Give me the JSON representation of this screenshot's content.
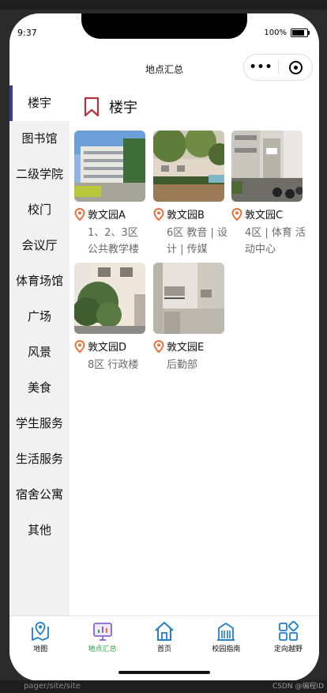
{
  "status": {
    "time": "9:37",
    "battery": "100%"
  },
  "nav": {
    "title": "地点汇总",
    "more_glyph": "•••"
  },
  "sidebar": {
    "items": [
      {
        "label": "楼宇",
        "active": true
      },
      {
        "label": "图书馆"
      },
      {
        "label": "二级学院"
      },
      {
        "label": "校门"
      },
      {
        "label": "会议厅"
      },
      {
        "label": "体育场馆"
      },
      {
        "label": "广场"
      },
      {
        "label": "风景"
      },
      {
        "label": "美食"
      },
      {
        "label": "学生服务"
      },
      {
        "label": "生活服务"
      },
      {
        "label": "宿舍公寓"
      },
      {
        "label": "其他"
      }
    ]
  },
  "section": {
    "title": "楼宇",
    "icon": "bookmark-icon"
  },
  "places": [
    {
      "name": "敦文园A",
      "desc": "1、2、3区 公共教学楼"
    },
    {
      "name": "敦文园B",
      "desc": "6区 教音 | 设计 | 传媒"
    },
    {
      "name": "敦文园C",
      "desc": "4区 | 体育 活动中心"
    },
    {
      "name": "敦文园D",
      "desc": "8区 行政楼"
    },
    {
      "name": "敦文园E",
      "desc": "后勤部"
    }
  ],
  "tabs": [
    {
      "label": "地图",
      "icon": "map-pin-icon"
    },
    {
      "label": "地点汇总",
      "icon": "chart-board-icon",
      "active": true
    },
    {
      "label": "首页",
      "icon": "home-icon"
    },
    {
      "label": "校园指南",
      "icon": "building-icon"
    },
    {
      "label": "定向越野",
      "icon": "grid-icon"
    }
  ],
  "ide": {
    "path": "pager/site/site",
    "watermark": "CSDN @编程ID"
  },
  "colors": {
    "accent": "#3e3a8c",
    "pin": "#e8703a",
    "tab_active": "#2aa548",
    "tab_icon": "#1f7fc9"
  }
}
